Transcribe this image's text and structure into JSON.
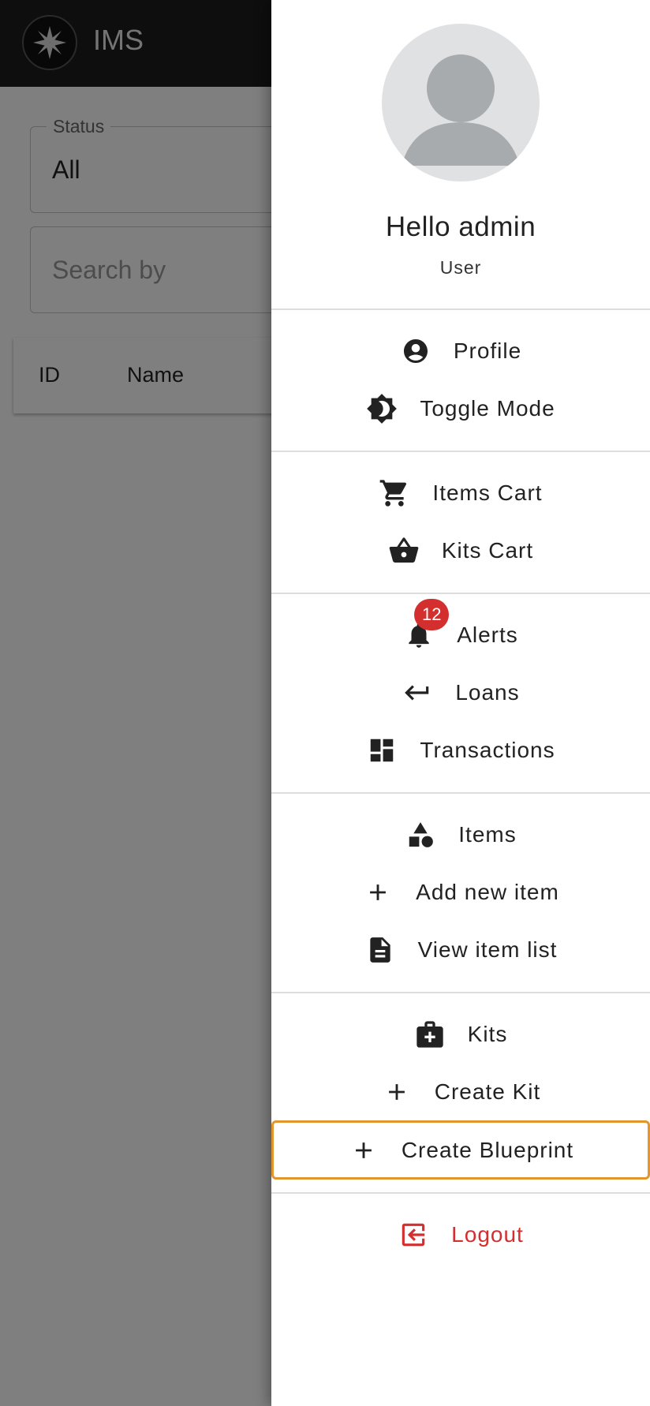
{
  "app": {
    "title": "IMS"
  },
  "filters": {
    "status_legend": "Status",
    "status_value": "All",
    "search_placeholder": "Search by"
  },
  "table": {
    "headers": [
      "ID",
      "Name"
    ]
  },
  "drawer": {
    "greeting": "Hello admin",
    "role": "User",
    "groups": [
      [
        {
          "label": "Profile",
          "icon": "account-circle-icon"
        },
        {
          "label": "Toggle Mode",
          "icon": "brightness-icon"
        }
      ],
      [
        {
          "label": "Items Cart",
          "icon": "cart-icon"
        },
        {
          "label": "Kits Cart",
          "icon": "basket-icon"
        }
      ],
      [
        {
          "label": "Alerts",
          "icon": "bell-icon",
          "badge": "12"
        },
        {
          "label": "Loans",
          "icon": "return-arrow-icon"
        },
        {
          "label": "Transactions",
          "icon": "dashboard-icon"
        }
      ],
      [
        {
          "label": "Items",
          "icon": "shapes-icon"
        },
        {
          "label": "Add new item",
          "icon": "plus-icon"
        },
        {
          "label": "View item list",
          "icon": "document-icon"
        }
      ],
      [
        {
          "label": "Kits",
          "icon": "medical-bag-icon"
        },
        {
          "label": "Create Kit",
          "icon": "plus-icon"
        },
        {
          "label": "Create Blueprint",
          "icon": "plus-icon",
          "focused": true
        }
      ]
    ],
    "logout": {
      "label": "Logout",
      "icon": "logout-icon"
    }
  },
  "colors": {
    "appbar": "#1c1c1c",
    "accent_danger": "#d32f2f",
    "focus_outline": "#e2962c"
  }
}
